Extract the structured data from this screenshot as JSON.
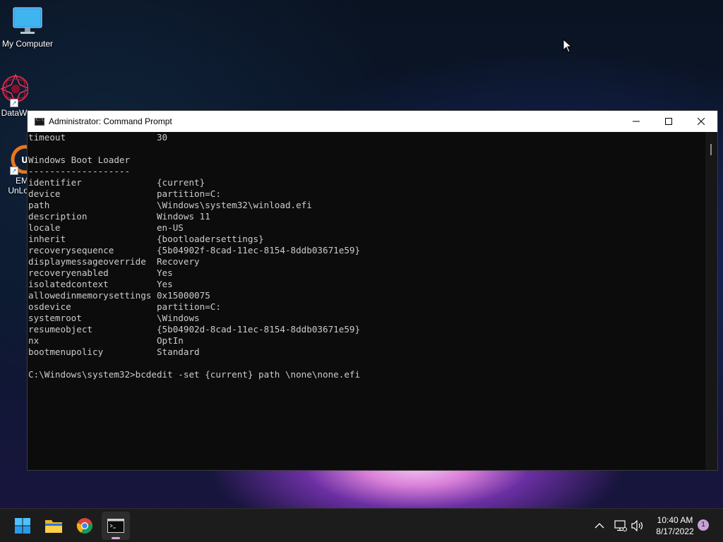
{
  "desktop": {
    "icons": [
      {
        "label": "My Computer",
        "icon": "monitor-icon"
      },
      {
        "label": "DataW",
        "icon": "datawing-logo-icon"
      },
      {
        "label": "EM\nUnLo",
        "icon": "em-unlock-icon"
      }
    ]
  },
  "window": {
    "title": "Administrator: Command Prompt",
    "minimize": "minimize-icon",
    "maximize": "maximize-icon",
    "close": "close-icon",
    "console_lines": [
      "timeout                 30",
      "",
      "Windows Boot Loader",
      "-------------------",
      "identifier              {current}",
      "device                  partition=C:",
      "path                    \\Windows\\system32\\winload.efi",
      "description             Windows 11",
      "locale                  en-US",
      "inherit                 {bootloadersettings}",
      "recoverysequence        {5b04902f-8cad-11ec-8154-8ddb03671e59}",
      "displaymessageoverride  Recovery",
      "recoveryenabled         Yes",
      "isolatedcontext         Yes",
      "allowedinmemorysettings 0x15000075",
      "osdevice                partition=C:",
      "systemroot              \\Windows",
      "resumeobject            {5b04902d-8cad-11ec-8154-8ddb03671e59}",
      "nx                      OptIn",
      "bootmenupolicy          Standard",
      "",
      "C:\\Windows\\system32>bcdedit -set {current} path \\none\\none.efi"
    ]
  },
  "taskbar": {
    "apps": [
      "start-icon",
      "file-explorer-icon",
      "chrome-icon",
      "command-prompt-icon"
    ],
    "time": "10:40 AM",
    "date": "8/17/2022",
    "notification_count": "1"
  },
  "colors": {
    "console_bg": "#0c0c0c",
    "console_text": "#cccccc",
    "taskbar_bg": "#1c1c1c"
  }
}
